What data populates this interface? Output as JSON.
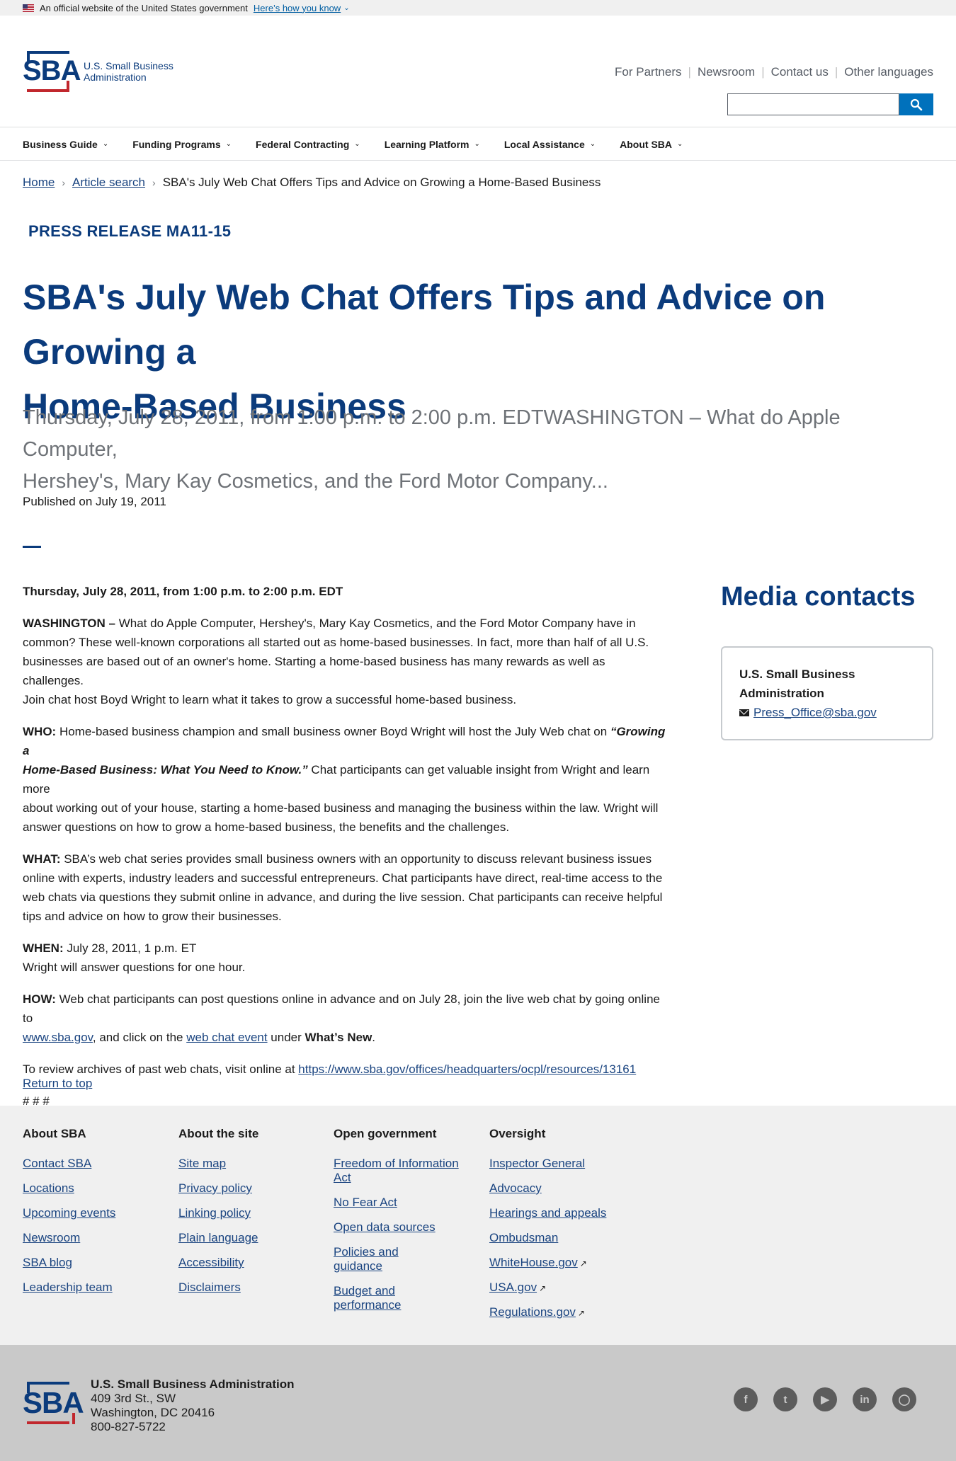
{
  "gov_banner": {
    "text": "An official website of the United States government",
    "link": "Here’s how you know"
  },
  "logo": {
    "mark": "SBA",
    "name": "U.S. Small Business Administration"
  },
  "utility_nav": [
    "For Partners",
    "Newsroom",
    "Contact us",
    "Other languages"
  ],
  "search": {
    "placeholder": ""
  },
  "main_nav": [
    "Business Guide",
    "Funding Programs",
    "Federal Contracting",
    "Learning Platform",
    "Local Assistance",
    "About SBA"
  ],
  "breadcrumb": [
    "Home",
    "Article search",
    "SBA's July Web Chat Offers Tips and Advice on Growing a Home-Based Business"
  ],
  "eyebrow": "PRESS RELEASE MA11-15",
  "title_lines": [
    "SBA's July Web Chat Offers Tips and Advice on Growing a",
    "Home-Based Business"
  ],
  "summary_lines": [
    "Thursday, July 28, 2011, from 1:00 p.m. to 2:00 p.m. EDTWASHINGTON – What do Apple Computer,",
    "Hershey's, Mary Kay Cosmetics, and the Ford Motor Company..."
  ],
  "published": "Published on July 19, 2011",
  "article": {
    "date_line": "Thursday, July 28, 2011, from 1:00 p.m. to 2:00 p.m. EDT",
    "washington_label": "WASHINGTON –",
    "washington_lines": [
      " What do Apple Computer, Hershey's, Mary Kay Cosmetics, and the Ford Motor Company have in",
      "common? These well-known corporations all started out as home-based businesses. In fact, more than half of all U.S.",
      "businesses are based out of an owner's home. Starting a home-based business has many rewards as well as challenges.",
      "Join chat host Boyd Wright to learn what it takes to grow a successful home-based business."
    ],
    "who_label": "WHO:",
    "who_line1": " Home-based business champion and small business owner Boyd Wright will host the July Web chat on ",
    "who_italic1": "“Growing a",
    "who_italic2": "Home-Based Business: What You Need to Know.”",
    "who_line2_rest": " Chat participants can get valuable insight from Wright and learn more",
    "who_lines": [
      "about working out of your house, starting a home-based business and managing the business within the law. Wright will",
      "answer questions on how to grow a home-based business, the benefits and the challenges."
    ],
    "what_label": "WHAT:",
    "what_lines": [
      " SBA’s web chat series provides small business owners with an opportunity to discuss relevant business issues",
      "online with experts, industry leaders and successful entrepreneurs. Chat participants have direct, real-time access to the",
      "web chats via questions they submit online in advance, and during the live session. Chat participants can receive helpful",
      "tips and advice on how to grow their businesses."
    ],
    "when_label": "WHEN:",
    "when_line1": " July 28, 2011, 1 p.m. ET",
    "when_line2": "Wright will answer questions for one hour.",
    "how_label": "HOW:",
    "how_line1": " Web chat participants can post questions online in advance and on July 28, join the live web chat by going online to",
    "how_link1": "www.sba.gov",
    "how_mid": ", and click on the ",
    "how_link2": "web chat event",
    "how_under": " under ",
    "how_bold": "What’s New",
    "how_end": ".",
    "archives_text": "To review archives of past web chats, visit online at ",
    "archives_link": "https://www.sba.gov/offices/headquarters/ocpl/resources/13161",
    "end_mark": "# # #"
  },
  "media": {
    "title": "Media contacts",
    "org_lines": [
      "U.S. Small Business",
      "Administration"
    ],
    "email": "Press_Office@sba.gov"
  },
  "return_top": "Return to top",
  "footer": [
    {
      "heading": "About SBA",
      "links": [
        "Contact SBA",
        "Locations",
        "Upcoming events",
        "Newsroom",
        "SBA blog",
        "Leadership team"
      ]
    },
    {
      "heading": "About the site",
      "links": [
        "Site map",
        "Privacy policy",
        "Linking policy",
        "Plain language",
        "Accessibility",
        "Disclaimers"
      ]
    },
    {
      "heading": "Open government",
      "links": [
        "Freedom of Information Act",
        "No Fear Act",
        "Open data sources",
        "Policies and guidance",
        "Budget and performance"
      ]
    },
    {
      "heading": "Oversight",
      "links": [
        "Inspector General",
        "Advocacy",
        "Hearings and appeals",
        "Ombudsman",
        "WhiteHouse.gov",
        "USA.gov",
        "Regulations.gov"
      ]
    }
  ],
  "address": {
    "name": "U.S. Small Business Administration",
    "street": "409 3rd St., SW",
    "city": "Washington, DC 20416",
    "phone": "800-827-5722"
  },
  "social": [
    "facebook-icon",
    "twitter-icon",
    "youtube-icon",
    "linkedin-icon",
    "instagram-icon"
  ],
  "colors": {
    "brand_navy": "#0b3b7c",
    "brand_red": "#c1272d",
    "link": "#1a4480",
    "search_button": "#0071bc"
  }
}
